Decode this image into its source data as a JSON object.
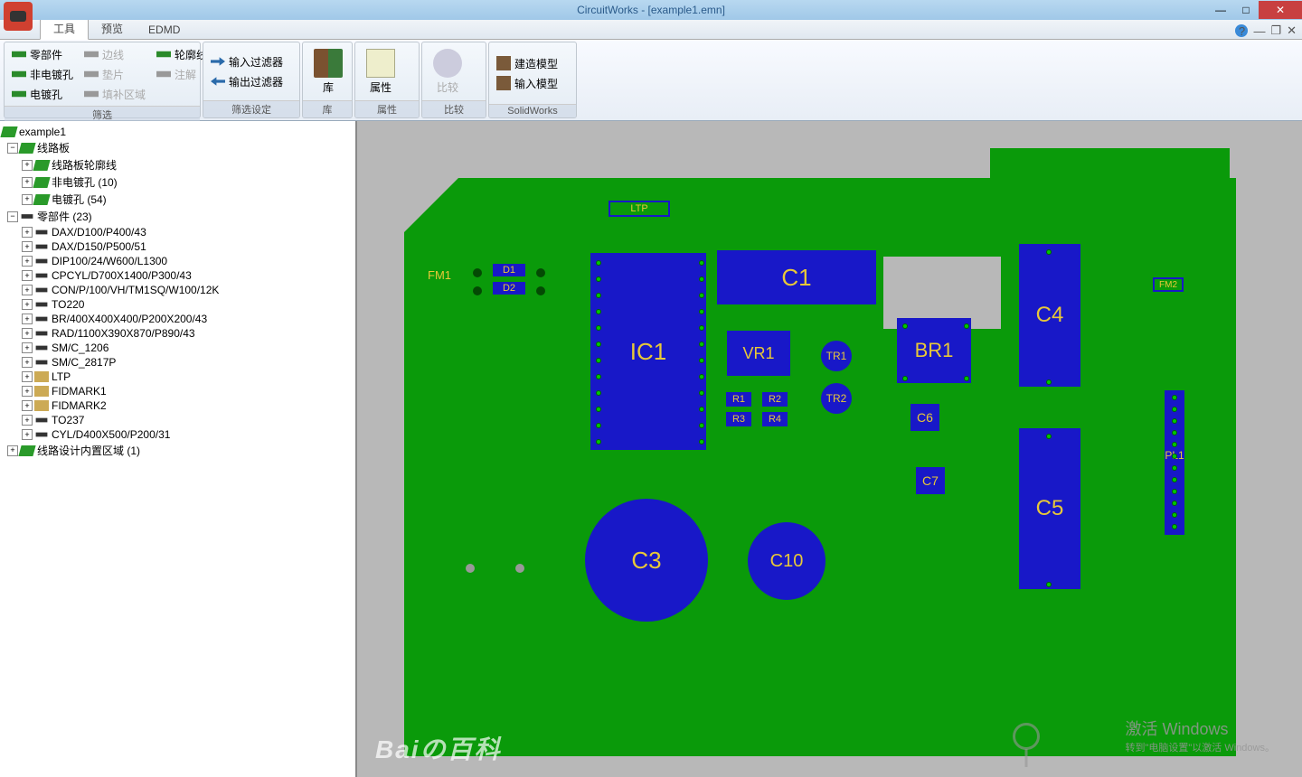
{
  "title": "CircuitWorks - [example1.emn]",
  "tabs": {
    "tools": "工具",
    "preview": "预览",
    "emdm": "EDMD"
  },
  "ribbon": {
    "filter": {
      "label": "筛选",
      "parts": "零部件",
      "edges": "边线",
      "outline": "轮廓线",
      "nonplated": "非电镀孔",
      "pads": "垫片",
      "notes": "注解",
      "plated": "电镀孔",
      "fillarea": "填补区域"
    },
    "filterset": {
      "label": "筛选设定",
      "in": "输入过滤器",
      "out": "输出过滤器"
    },
    "lib": {
      "label": "库",
      "btn": "库"
    },
    "attr": {
      "label": "属性",
      "btn": "属性"
    },
    "compare": {
      "label": "比较",
      "btn": "比较"
    },
    "sw": {
      "label": "SolidWorks",
      "build": "建造模型",
      "import": "输入模型"
    }
  },
  "tree": {
    "root": "example1",
    "board": "线路板",
    "board_children": [
      {
        "l": "线路板轮廓线"
      },
      {
        "l": "非电镀孔 (10)"
      },
      {
        "l": "电镀孔 (54)"
      }
    ],
    "parts": "零部件 (23)",
    "parts_children": [
      "DAX/D100/P400/43",
      "DAX/D150/P500/51",
      "DIP100/24/W600/L1300",
      "CPCYL/D700X1400/P300/43",
      "CON/P/100/VH/TM1SQ/W100/12K",
      "TO220",
      "BR/400X400X400/P200X200/43",
      "RAD/1100X390X870/P890/43",
      "SM/C_1206",
      "SM/C_2817P",
      "LTP",
      "FIDMARK1",
      "FIDMARK2",
      "TO237",
      "CYL/D400X500/P200/31"
    ],
    "keepout": "线路设计内置区域 (1)"
  },
  "pcb": {
    "LTP": "LTP",
    "FM1": "FM1",
    "FM2": "FM2",
    "D1": "D1",
    "D2": "D2",
    "IC1": "IC1",
    "C1": "C1",
    "VR1": "VR1",
    "TR1": "TR1",
    "TR2": "TR2",
    "BR1": "BR1",
    "R1": "R1",
    "R2": "R2",
    "R3": "R3",
    "R4": "R4",
    "C4": "C4",
    "C5": "C5",
    "C6": "C6",
    "C7": "C7",
    "PL1": "PL1",
    "C3": "C3",
    "C10": "C10"
  },
  "watermark": {
    "baidu": "Baiの百科",
    "win1": "激活 Windows",
    "win2": "转到\"电脑设置\"以激活 Windows。"
  }
}
